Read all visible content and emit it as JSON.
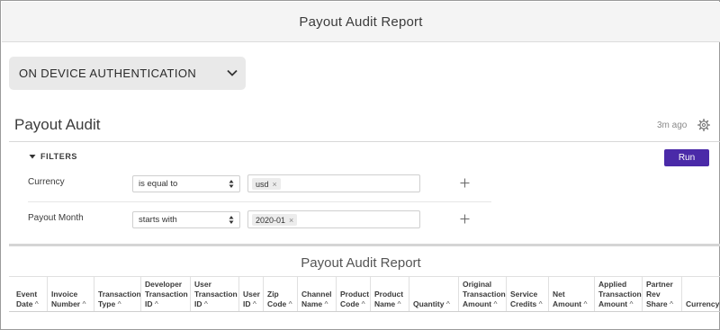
{
  "header": {
    "title": "Payout Audit Report"
  },
  "dashboard_select": {
    "value": "ON DEVICE AUTHENTICATION",
    "icon": "chevron-down-icon"
  },
  "section": {
    "title": "Payout Audit",
    "updated": "3m ago",
    "icon": "gear-icon"
  },
  "filters": {
    "toggle_label": "FILTERS",
    "run_label": "Run",
    "run_color": "#4a2aa8",
    "rows": [
      {
        "label": "Currency",
        "operator": "is equal to",
        "values": [
          "usd"
        ]
      },
      {
        "label": "Payout Month",
        "operator": "starts with",
        "values": [
          "2020-01"
        ]
      }
    ]
  },
  "report": {
    "title": "Payout Audit Report",
    "sort_indicator": "^",
    "columns": [
      {
        "lines": [
          "Event",
          "Date"
        ]
      },
      {
        "lines": [
          "Invoice",
          "Number"
        ]
      },
      {
        "lines": [
          "Transaction",
          "Type"
        ]
      },
      {
        "lines": [
          "Developer",
          "Transaction",
          "ID"
        ]
      },
      {
        "lines": [
          "User",
          "Transaction",
          "ID"
        ]
      },
      {
        "lines": [
          "User",
          "ID"
        ]
      },
      {
        "lines": [
          "Zip",
          "Code"
        ]
      },
      {
        "lines": [
          "Channel",
          "Name"
        ]
      },
      {
        "lines": [
          "Product",
          "Code"
        ]
      },
      {
        "lines": [
          "Product",
          "Name"
        ]
      },
      {
        "lines": [
          "Quantity"
        ]
      },
      {
        "lines": [
          "Original",
          "Transaction",
          "Amount"
        ]
      },
      {
        "lines": [
          "Service",
          "Credits"
        ]
      },
      {
        "lines": [
          "Net",
          "Amount"
        ]
      },
      {
        "lines": [
          "Applied",
          "Transaction",
          "Amount"
        ]
      },
      {
        "lines": [
          "Partner",
          "Rev",
          "Share"
        ]
      },
      {
        "lines": [
          "Currency"
        ]
      }
    ]
  }
}
